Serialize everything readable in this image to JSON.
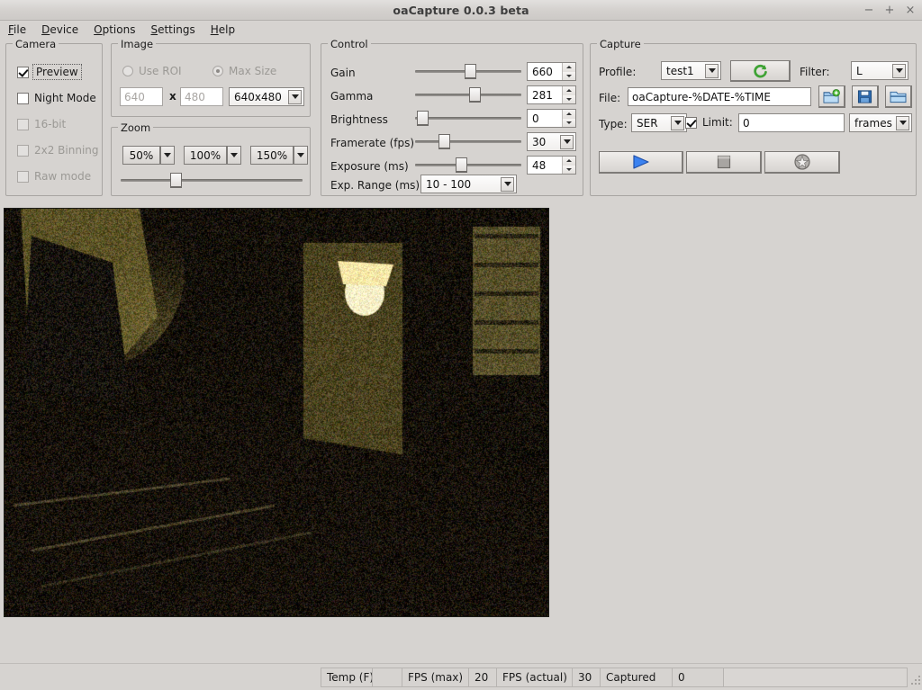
{
  "window": {
    "title": "oaCapture 0.0.3 beta",
    "buttons": {
      "minimize": "−",
      "maximize": "+",
      "close": "×"
    }
  },
  "menubar": {
    "items": [
      {
        "label": "File",
        "accel": "F"
      },
      {
        "label": "Device",
        "accel": "D"
      },
      {
        "label": "Options",
        "accel": "O"
      },
      {
        "label": "Settings",
        "accel": "S"
      },
      {
        "label": "Help",
        "accel": "H"
      }
    ]
  },
  "camera": {
    "title": "Camera",
    "checkboxes": [
      {
        "label": "Preview",
        "checked": true,
        "enabled": true,
        "focused": true
      },
      {
        "label": "Night Mode",
        "checked": false,
        "enabled": true,
        "focused": false
      },
      {
        "label": "16-bit",
        "checked": false,
        "enabled": false,
        "focused": false
      },
      {
        "label": "2x2 Binning",
        "checked": false,
        "enabled": false,
        "focused": false
      },
      {
        "label": "Raw mode",
        "checked": false,
        "enabled": false,
        "focused": false
      }
    ]
  },
  "image": {
    "title": "Image",
    "radios": [
      {
        "label": "Use ROI",
        "selected": false,
        "enabled": false
      },
      {
        "label": "Max Size",
        "selected": true,
        "enabled": false
      }
    ],
    "width_value": "640",
    "separator": "x",
    "height_value": "480",
    "size_combo_value": "640x480"
  },
  "zoom": {
    "title": "Zoom",
    "buttons": [
      "50%",
      "100%",
      "150%"
    ],
    "slider_percent": 29
  },
  "control": {
    "title": "Control",
    "rows": [
      {
        "label": "Gain",
        "value": "660",
        "widget": "spin",
        "slider_percent": 52
      },
      {
        "label": "Gamma",
        "value": "281",
        "widget": "spin",
        "slider_percent": 57
      },
      {
        "label": "Brightness",
        "value": "0",
        "widget": "spin",
        "slider_percent": 2
      },
      {
        "label": "Framerate (fps)",
        "value": "30",
        "widget": "combo",
        "slider_percent": 25
      },
      {
        "label": "Exposure (ms)",
        "value": "48",
        "widget": "spin",
        "slider_percent": 43
      }
    ],
    "exp_range_label": "Exp. Range (ms)",
    "exp_range_value": "10 - 100"
  },
  "capture": {
    "title": "Capture",
    "profile_label": "Profile:",
    "profile_value": "test1",
    "reload_icon": "reload-icon",
    "filter_label": "Filter:",
    "filter_value": "L",
    "file_label": "File:",
    "file_value": "oaCapture-%DATE-%TIME",
    "file_buttons": [
      "new-folder-icon",
      "save-icon",
      "open-folder-icon"
    ],
    "type_label": "Type:",
    "type_value": "SER",
    "limit_label": "Limit:",
    "limit_checked": true,
    "limit_value": "0",
    "limit_units": "frames",
    "actions": [
      "play-icon",
      "stop-icon",
      "autorun-icon"
    ]
  },
  "statusbar": {
    "cells": [
      {
        "label": "Temp (F)",
        "value": ""
      },
      {
        "label": "FPS (max)",
        "value": "20"
      },
      {
        "label": "FPS (actual)",
        "value": "30"
      },
      {
        "label": "Captured",
        "value": "0"
      }
    ]
  },
  "colors": {
    "window_bg": "#d6d3d0",
    "accent_green": "#3fa335",
    "accent_blue": "#2b6fd4",
    "preview_border": "#1c1c18"
  }
}
